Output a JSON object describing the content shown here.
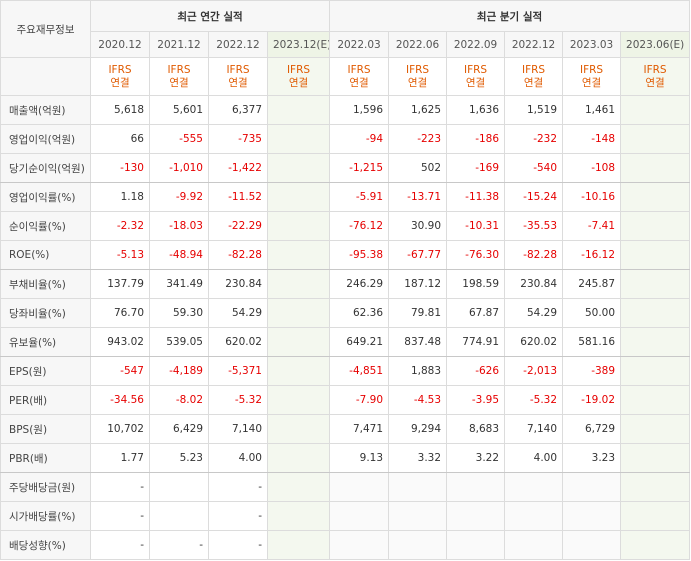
{
  "header": {
    "corner": "주요재무정보",
    "annual_group": "최근 연간 실적",
    "quarter_group": "최근 분기 실적"
  },
  "periods": [
    "2020.12",
    "2021.12",
    "2022.12",
    "2023.12(E)",
    "2022.03",
    "2022.06",
    "2022.09",
    "2022.12",
    "2023.03",
    "2023.06(E)"
  ],
  "ifrs": {
    "line1": "IFRS",
    "line2": "연결"
  },
  "rows": [
    {
      "label": "매출액(억원)",
      "values": [
        "5,618",
        "5,601",
        "6,377",
        "",
        "1,596",
        "1,625",
        "1,636",
        "1,519",
        "1,461",
        ""
      ]
    },
    {
      "label": "영업이익(억원)",
      "values": [
        "66",
        "-555",
        "-735",
        "",
        "-94",
        "-223",
        "-186",
        "-232",
        "-148",
        ""
      ]
    },
    {
      "label": "당기순이익(억원)",
      "values": [
        "-130",
        "-1,010",
        "-1,422",
        "",
        "-1,215",
        "502",
        "-169",
        "-540",
        "-108",
        ""
      ]
    },
    {
      "label": "영업이익률(%)",
      "values": [
        "1.18",
        "-9.92",
        "-11.52",
        "",
        "-5.91",
        "-13.71",
        "-11.38",
        "-15.24",
        "-10.16",
        ""
      ]
    },
    {
      "label": "순이익률(%)",
      "values": [
        "-2.32",
        "-18.03",
        "-22.29",
        "",
        "-76.12",
        "30.90",
        "-10.31",
        "-35.53",
        "-7.41",
        ""
      ]
    },
    {
      "label": "ROE(%)",
      "values": [
        "-5.13",
        "-48.94",
        "-82.28",
        "",
        "-95.38",
        "-67.77",
        "-76.30",
        "-82.28",
        "-16.12",
        ""
      ]
    },
    {
      "label": "부채비율(%)",
      "values": [
        "137.79",
        "341.49",
        "230.84",
        "",
        "246.29",
        "187.12",
        "198.59",
        "230.84",
        "245.87",
        ""
      ]
    },
    {
      "label": "당좌비율(%)",
      "values": [
        "76.70",
        "59.30",
        "54.29",
        "",
        "62.36",
        "79.81",
        "67.87",
        "54.29",
        "50.00",
        ""
      ]
    },
    {
      "label": "유보율(%)",
      "values": [
        "943.02",
        "539.05",
        "620.02",
        "",
        "649.21",
        "837.48",
        "774.91",
        "620.02",
        "581.16",
        ""
      ]
    },
    {
      "label": "EPS(원)",
      "values": [
        "-547",
        "-4,189",
        "-5,371",
        "",
        "-4,851",
        "1,883",
        "-626",
        "-2,013",
        "-389",
        ""
      ]
    },
    {
      "label": "PER(배)",
      "values": [
        "-34.56",
        "-8.02",
        "-5.32",
        "",
        "-7.90",
        "-4.53",
        "-3.95",
        "-5.32",
        "-19.02",
        ""
      ]
    },
    {
      "label": "BPS(원)",
      "values": [
        "10,702",
        "6,429",
        "7,140",
        "",
        "7,471",
        "9,294",
        "8,683",
        "7,140",
        "6,729",
        ""
      ]
    },
    {
      "label": "PBR(배)",
      "values": [
        "1.77",
        "5.23",
        "4.00",
        "",
        "9.13",
        "3.32",
        "3.22",
        "4.00",
        "3.23",
        ""
      ]
    },
    {
      "label": "주당배당금(원)",
      "values": [
        "-",
        "",
        "-",
        "",
        "",
        "",
        "",
        "",
        "",
        ""
      ]
    },
    {
      "label": "시가배당률(%)",
      "values": [
        "-",
        "",
        "-",
        "",
        "",
        "",
        "",
        "",
        "",
        ""
      ]
    },
    {
      "label": "배당성향(%)",
      "values": [
        "-",
        "-",
        "-",
        "",
        "",
        "",
        "",
        "",
        "",
        ""
      ]
    }
  ],
  "colors": {
    "negative": "#e60000",
    "ifrs": "#e05a00",
    "estimate_bg": "#f4f8ef"
  }
}
